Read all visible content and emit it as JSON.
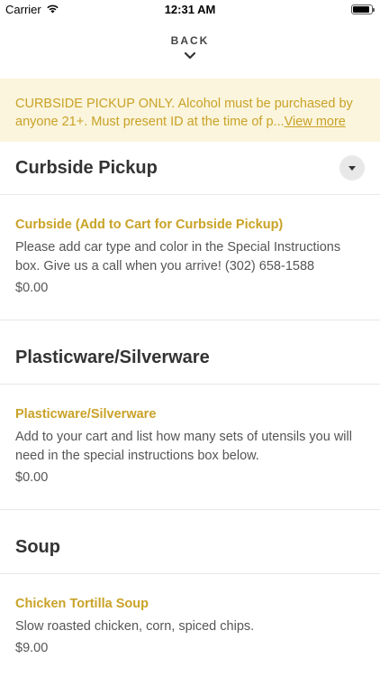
{
  "status": {
    "carrier": "Carrier",
    "time": "12:31 AM",
    "battery_level": 0.9
  },
  "back_label": "BACK",
  "notice": {
    "line1": "CURBSIDE PICKUP ONLY. Alcohol must be purchased by",
    "line2": "anyone 21+. Must present ID at the time of p...",
    "view_more": "View more"
  },
  "sections": [
    {
      "title": "Curbside Pickup",
      "items": [
        {
          "name": "Curbside (Add to Cart for Curbside Pickup)",
          "desc": "Please add car type and color in the Special Instructions box. Give us a call when you arrive! (302) 658-1588",
          "price": "$0.00"
        }
      ]
    },
    {
      "title": "Plasticware/Silverware",
      "items": [
        {
          "name": "Plasticware/Silverware",
          "desc": "Add to your cart and list how many sets of utensils you will need in the special instructions box below.",
          "price": "$0.00"
        }
      ]
    },
    {
      "title": "Soup",
      "items": [
        {
          "name": "Chicken Tortilla Soup",
          "desc": "Slow roasted chicken, corn, spiced chips.",
          "price": "$9.00"
        }
      ]
    }
  ],
  "colors": {
    "accent": "#c9a227",
    "notice_bg": "#fbf5dd",
    "divider": "#e8e8e8"
  }
}
